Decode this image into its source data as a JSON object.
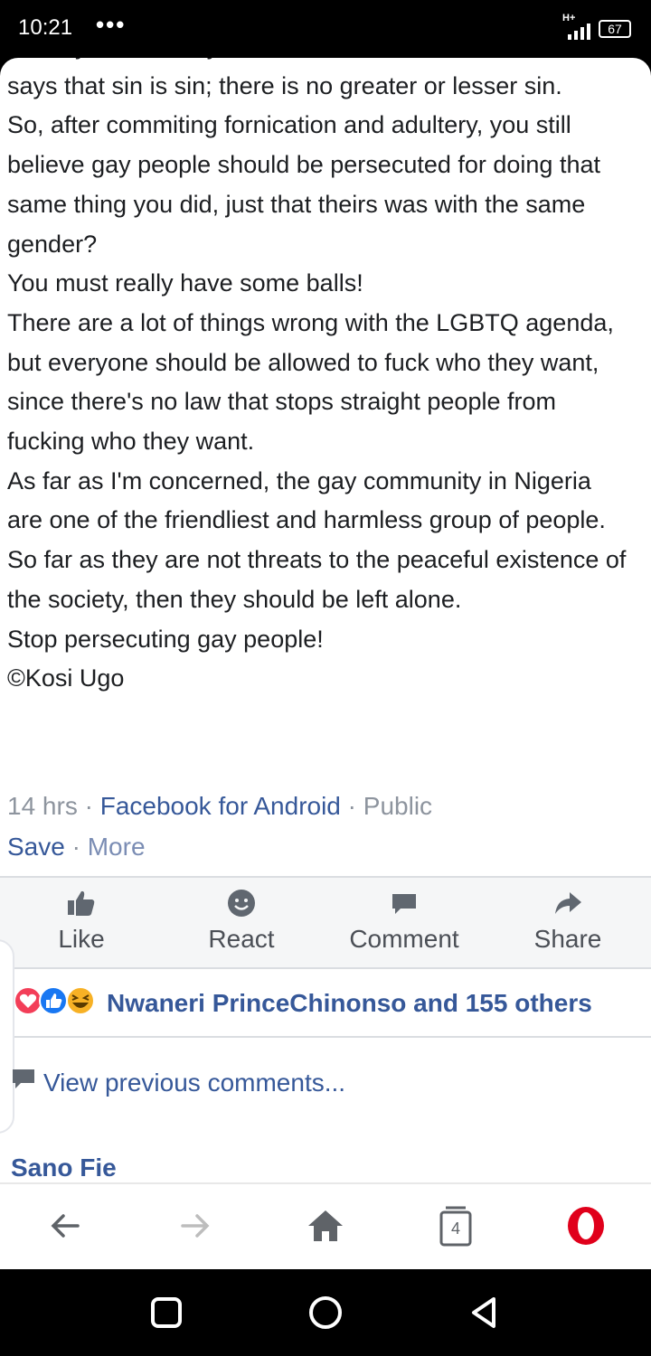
{
  "status_bar": {
    "time": "10:21",
    "dots": "•••",
    "network": "H+",
    "battery": "67"
  },
  "post": {
    "paragraphs": [
      "country and it really baffles me, because even the Bible says that sin is sin; there is no greater or lesser sin.",
      "So, after commiting fornication and adultery, you still believe gay people should be persecuted for doing that same thing you did, just that theirs was with the same gender?",
      "You must really have some balls!",
      "There are a lot of things wrong with the LGBTQ agenda, but everyone should be allowed to fuck who they want, since there's no law that stops straight people from fucking who they want.",
      "As far as I'm concerned, the gay community in Nigeria are one of the friendliest and harmless group of people. So far as they are not threats to the peaceful existence of the society, then they should be left alone.",
      "Stop persecuting gay people!",
      "©Kosi Ugo"
    ],
    "time_ago": "14 hrs",
    "separator": " · ",
    "source": "Facebook for Android",
    "privacy": "Public",
    "save_label": "Save",
    "more_label": "More"
  },
  "actions": {
    "like": "Like",
    "react": "React",
    "comment": "Comment",
    "share": "Share"
  },
  "reactions": {
    "summary": "Nwaneri PrinceChinonso and 155 others"
  },
  "comments": {
    "view_previous": "View previous comments...",
    "first_commenter": "Sano Fie"
  },
  "browser_bar": {
    "tabs_count": "4"
  },
  "colors": {
    "link": "#365899",
    "text": "#1c1e21",
    "muted": "#8d949e",
    "opera_red": "#e0001b"
  }
}
